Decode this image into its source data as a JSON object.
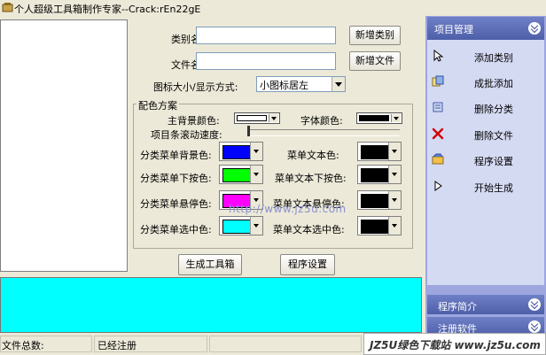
{
  "window": {
    "title": "个人超级工具箱制作专家--Crack:rEn22gE"
  },
  "form": {
    "category_label": "类别名:",
    "category_value": "",
    "add_category_button": "新增类别",
    "file_label": "文件名:",
    "file_value": "",
    "add_file_button": "新增文件",
    "icon_size_label": "图标大小/显示方式:",
    "icon_size_value": "小图标居左"
  },
  "colors_group": {
    "title": "配色方案",
    "main_bg_label": "主背景颜色:",
    "main_bg_color": "#ffffff",
    "font_color_label": "字体颜色:",
    "font_color": "#000000",
    "scroll_speed_label": "项目条滚动速度:",
    "cat_bg_label": "分类菜单背景色:",
    "cat_bg_color": "#0000ff",
    "cat_pressed_label": "分类菜单下按色:",
    "cat_pressed_color": "#00ff00",
    "cat_hover_label": "分类菜单悬停色:",
    "cat_hover_color": "#ff00ff",
    "cat_selected_label": "分类菜单选中色:",
    "cat_selected_color": "#00ffff",
    "menu_text_label": "菜单文本色:",
    "menu_text_color": "#000000",
    "menu_text_pressed_label": "菜单文本下按色:",
    "menu_text_pressed_color": "#000000",
    "menu_text_hover_label": "菜单文本悬停色:",
    "menu_text_hover_color": "#000000",
    "menu_text_selected_label": "菜单文本选中色:",
    "menu_text_selected_color": "#000000"
  },
  "watermark": "http://www.jz5u.com",
  "actions": {
    "generate_button": "生成工具箱",
    "settings_button": "程序设置"
  },
  "status": {
    "file_total_label": "文件总数:",
    "registered": "已经注册"
  },
  "sidebar": {
    "header": "项目管理",
    "items": [
      {
        "label": "添加类别",
        "icon": "cursor-arrow-icon"
      },
      {
        "label": "成批添加",
        "icon": "batch-add-icon"
      },
      {
        "label": "删除分类",
        "icon": "delete-category-icon"
      },
      {
        "label": "删除文件",
        "icon": "red-x-icon"
      },
      {
        "label": "程序设置",
        "icon": "settings-icon"
      },
      {
        "label": "开始生成",
        "icon": "play-icon"
      }
    ],
    "intro": "程序简介",
    "register": "注册软件"
  },
  "brand": {
    "text": "JZ5U绿色下载站 www.jz5u.com"
  }
}
